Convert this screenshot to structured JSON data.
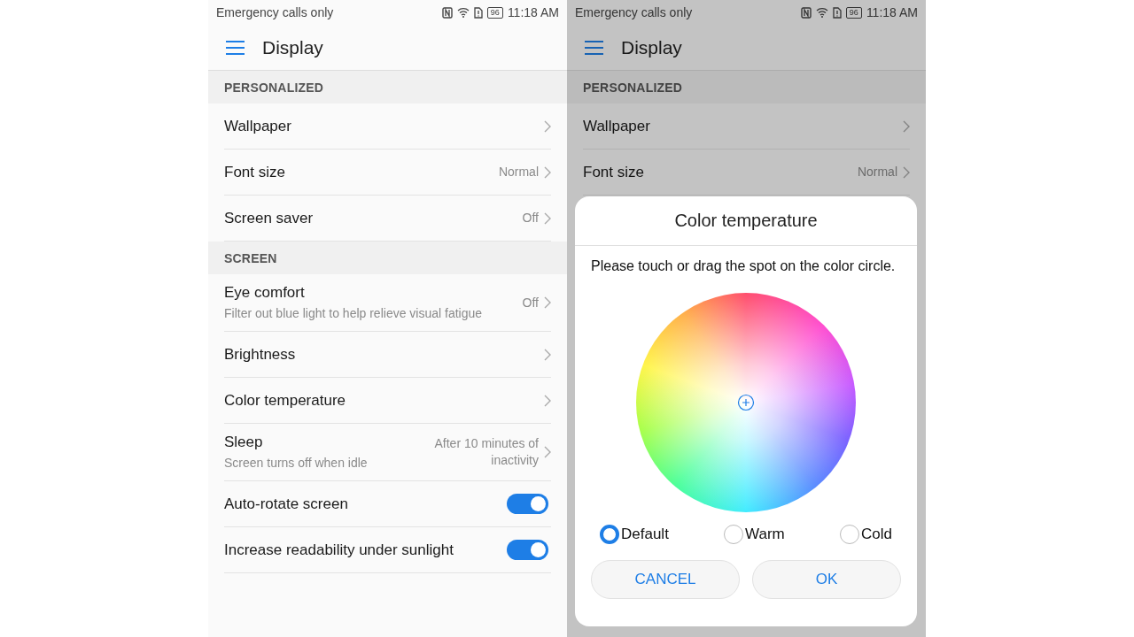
{
  "left_screen": {
    "status_bar": {
      "carrier": "Emergency calls only",
      "battery": "96",
      "time": "11:18 AM"
    },
    "app_bar": {
      "title": "Display"
    },
    "sections": [
      {
        "header": "PERSONALIZED",
        "rows": [
          {
            "kind": "link",
            "label": "Wallpaper"
          },
          {
            "kind": "link",
            "label": "Font size",
            "value": "Normal"
          },
          {
            "kind": "link",
            "label": "Screen saver",
            "value": "Off"
          }
        ]
      },
      {
        "header": "SCREEN",
        "rows": [
          {
            "kind": "link",
            "label": "Eye comfort",
            "subtitle": "Filter out blue light to help relieve visual fatigue",
            "value": "Off"
          },
          {
            "kind": "link",
            "label": "Brightness"
          },
          {
            "kind": "link",
            "label": "Color temperature"
          },
          {
            "kind": "link",
            "label": "Sleep",
            "subtitle": "Screen turns off when idle",
            "value": "After 10 minutes of inactivity"
          },
          {
            "kind": "toggle",
            "label": "Auto-rotate screen",
            "on": true
          },
          {
            "kind": "toggle",
            "label": "Increase readability under sunlight",
            "on": true
          }
        ]
      }
    ]
  },
  "right_screen": {
    "status_bar": {
      "carrier": "Emergency calls only",
      "battery": "96",
      "time": "11:18 AM"
    },
    "app_bar": {
      "title": "Display"
    },
    "sections": [
      {
        "header": "PERSONALIZED",
        "rows": [
          {
            "kind": "link",
            "label": "Wallpaper"
          },
          {
            "kind": "link",
            "label": "Font size",
            "value": "Normal"
          }
        ]
      }
    ],
    "dialog": {
      "title": "Color temperature",
      "message": "Please touch or drag the spot on the color circle.",
      "options": [
        {
          "label": "Default",
          "selected": true
        },
        {
          "label": "Warm",
          "selected": false
        },
        {
          "label": "Cold",
          "selected": false
        }
      ],
      "buttons": [
        "CANCEL",
        "OK"
      ]
    }
  }
}
